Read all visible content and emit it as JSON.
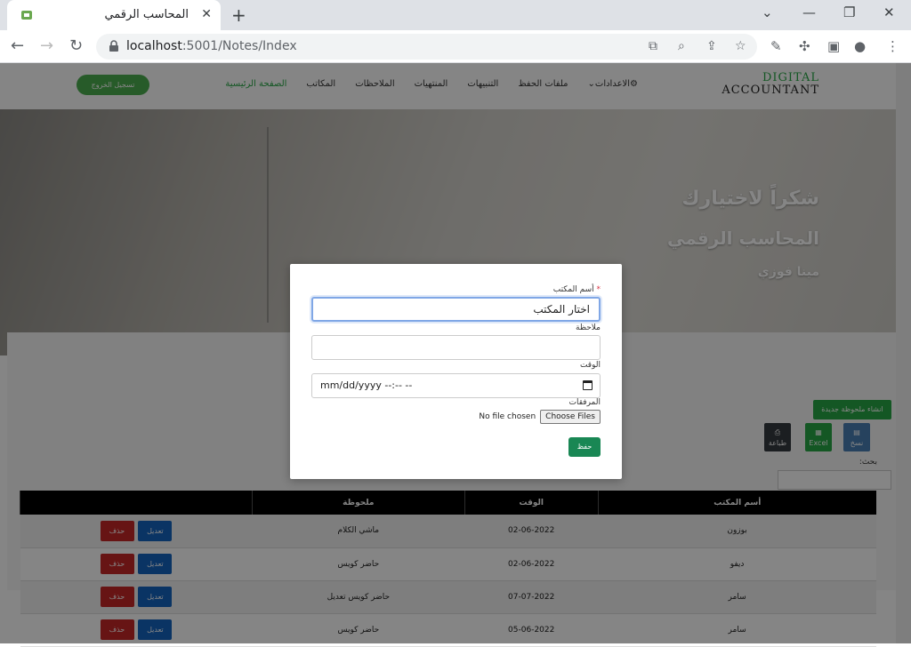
{
  "browser": {
    "tab_title": "المحاسب الرقمي",
    "url_host": "localhost",
    "url_rest": ":5001/Notes/Index"
  },
  "site": {
    "brand_line1": "DIGITAL",
    "brand_line2": "ACCOUNTANT",
    "nav": [
      "الصفحة الرئيسية",
      "المكاتب",
      "الملاحظات",
      "المنتهيات",
      "التنبيهات",
      "ملفات الحفظ",
      "الاعدادات"
    ],
    "logout": "تسجيل الخروج"
  },
  "hero": {
    "line1": "شكراً لاختيارك",
    "line2": "المحاسب الرقمي",
    "line3": "مينا فوزي"
  },
  "toolbar": {
    "new_note": "انشاء ملحوظة جديدة",
    "copy": "نسخ",
    "excel": "Excel",
    "print": "طباعة",
    "search_label": "بحث:"
  },
  "table": {
    "headers": [
      "أسم المكتب",
      "الوقت",
      "ملحوظة",
      ""
    ],
    "edit": "تعديل",
    "delete": "حذف",
    "rows": [
      {
        "office": "بوزون",
        "date": "02-06-2022",
        "note": "ماشي الكلام"
      },
      {
        "office": "ديفو",
        "date": "02-06-2022",
        "note": "حاضر كويس"
      },
      {
        "office": "سامر",
        "date": "07-07-2022",
        "note": "حاضر كويس تعديل"
      },
      {
        "office": "سامر",
        "date": "05-06-2022",
        "note": "حاضر كويس"
      }
    ]
  },
  "modal": {
    "office_label": "أسم المكتب",
    "required_mark": "*",
    "office_value": "اختار المكتب",
    "note_label": "ملاحظة",
    "note_value": "",
    "time_label": "الوقت",
    "time_value": "mm/dd/yyyy --:-- --",
    "attachments_label": "المرفقات",
    "choose_files": "Choose Files",
    "no_file": "No file chosen",
    "save": "حفظ"
  }
}
